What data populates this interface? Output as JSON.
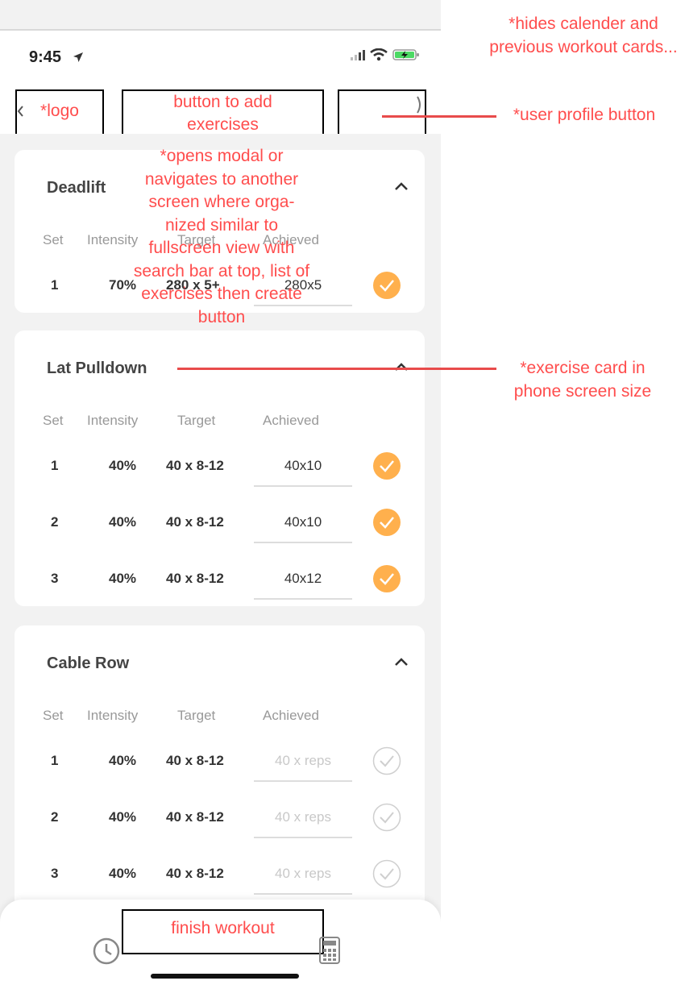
{
  "status_bar": {
    "time": "9:45"
  },
  "header": {
    "logo_label": "*logo",
    "add_exercise_label": "button to add exercises"
  },
  "exercise_columns": [
    "Set",
    "Intensity",
    "Target",
    "Achieved"
  ],
  "exercises": [
    {
      "name": "Deadlift",
      "sets": [
        {
          "set": "1",
          "intensity": "70%",
          "target": "280 x 5+",
          "achieved": "280x5",
          "done": true
        }
      ]
    },
    {
      "name": "Lat Pulldown",
      "sets": [
        {
          "set": "1",
          "intensity": "40%",
          "target": "40 x 8-12",
          "achieved": "40x10",
          "done": true
        },
        {
          "set": "2",
          "intensity": "40%",
          "target": "40 x 8-12",
          "achieved": "40x10",
          "done": true
        },
        {
          "set": "3",
          "intensity": "40%",
          "target": "40 x 8-12",
          "achieved": "40x12",
          "done": true
        }
      ]
    },
    {
      "name": "Cable Row",
      "sets": [
        {
          "set": "1",
          "intensity": "40%",
          "target": "40 x 8-12",
          "placeholder": "40 x reps",
          "done": false
        },
        {
          "set": "2",
          "intensity": "40%",
          "target": "40 x 8-12",
          "placeholder": "40 x reps",
          "done": false
        },
        {
          "set": "3",
          "intensity": "40%",
          "target": "40 x 8-12",
          "placeholder": "40 x reps",
          "done": false
        }
      ]
    }
  ],
  "bottom_bar": {
    "finish_label": "finish workout"
  },
  "annotations": {
    "hides_calendar": "*hides calender and previous workout cards...",
    "user_profile": "*user profile button",
    "opens_modal": "*opens modal or navigates to another screen where orga-nized similar to fullscreen view with search bar at top, list of exercises then create button",
    "exercise_card": "*exercise card in phone screen size"
  },
  "colors": {
    "accent_orange": "#ffb04d",
    "annotation_red": "#ff4d4d",
    "annotation_line": "#e84b4b",
    "background": "#f2f2f2"
  },
  "icons": [
    "location-arrow-icon",
    "signal-icon",
    "wifi-icon",
    "battery-charging-icon",
    "chevron-left-icon",
    "chevron-up-icon",
    "check-circle-icon",
    "clock-icon",
    "calculator-icon"
  ]
}
